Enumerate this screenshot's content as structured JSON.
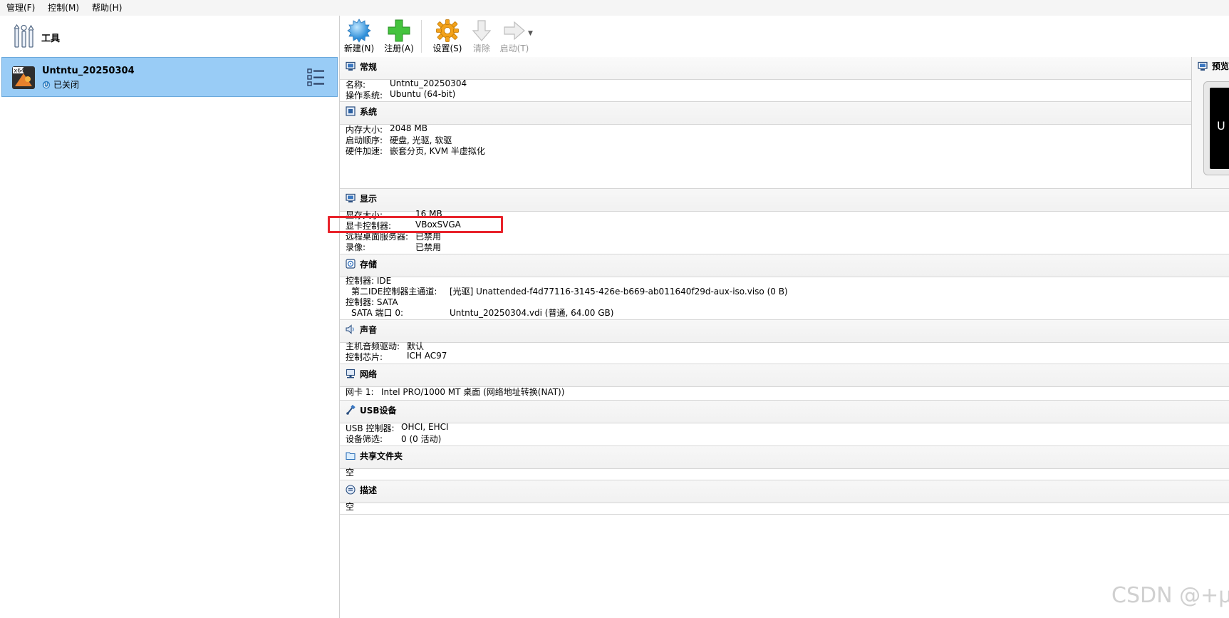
{
  "menu": [
    "管理(F)",
    "控制(M)",
    "帮助(H)"
  ],
  "sidebar": {
    "tools_label": "工具",
    "vm": {
      "name": "Untntu_20250304",
      "state": "已关闭",
      "os_badge": "x64"
    }
  },
  "toolbar": {
    "new_label": "新建(N)",
    "register_label": "注册(A)",
    "settings_label": "设置(S)",
    "discard_label": "清除",
    "start_label": "启动(T)"
  },
  "sections": {
    "general": {
      "title": "常规",
      "name_key": "名称:",
      "name_val": "Untntu_20250304",
      "os_key": "操作系统:",
      "os_val": "Ubuntu (64-bit)"
    },
    "system": {
      "title": "系统",
      "mem_key": "内存大小:",
      "mem_val": "2048 MB",
      "boot_key": "启动顺序:",
      "boot_val": "硬盘, 光驱, 软驱",
      "accel_key": "硬件加速:",
      "accel_val": "嵌套分页, KVM 半虚拟化"
    },
    "display": {
      "title": "显示",
      "vram_key": "显存大小:",
      "vram_val": "16 MB",
      "ctrl_key": "显卡控制器:",
      "ctrl_val": "VBoxSVGA",
      "rdp_key": "远程桌面服务器:",
      "rdp_val": "已禁用",
      "rec_key": "录像:",
      "rec_val": "已禁用"
    },
    "storage": {
      "title": "存储",
      "ide_ctrl": "控制器: IDE",
      "ide_port_key": "第二IDE控制器主通道:",
      "ide_port_val": "[光驱] Unattended-f4d77116-3145-426e-b669-ab011640f29d-aux-iso.viso (0 B)",
      "sata_ctrl": "控制器: SATA",
      "sata_port_key": "SATA 端口 0:",
      "sata_port_val": "Untntu_20250304.vdi (普通, 64.00 GB)"
    },
    "audio": {
      "title": "声音",
      "driver_key": "主机音频驱动:",
      "driver_val": "默认",
      "chip_key": "控制芯片:",
      "chip_val": "ICH AC97"
    },
    "network": {
      "title": "网络",
      "nic_key": "网卡 1:",
      "nic_val": "Intel PRO/1000 MT 桌面 (网络地址转换(NAT))"
    },
    "usb": {
      "title": "USB设备",
      "ctrl_key": "USB 控制器:",
      "ctrl_val": "OHCI, EHCI",
      "filter_key": "设备筛选:",
      "filter_val": "0 (0 活动)"
    },
    "shared": {
      "title": "共享文件夹",
      "value": "空"
    },
    "description": {
      "title": "描述",
      "value": "空"
    }
  },
  "preview": {
    "title": "预览",
    "screen_text": "U"
  },
  "watermark": "CSDN @+µ",
  "colors": {
    "selection_bg": "#99ccf6",
    "highlight_border": "#e8232b"
  }
}
